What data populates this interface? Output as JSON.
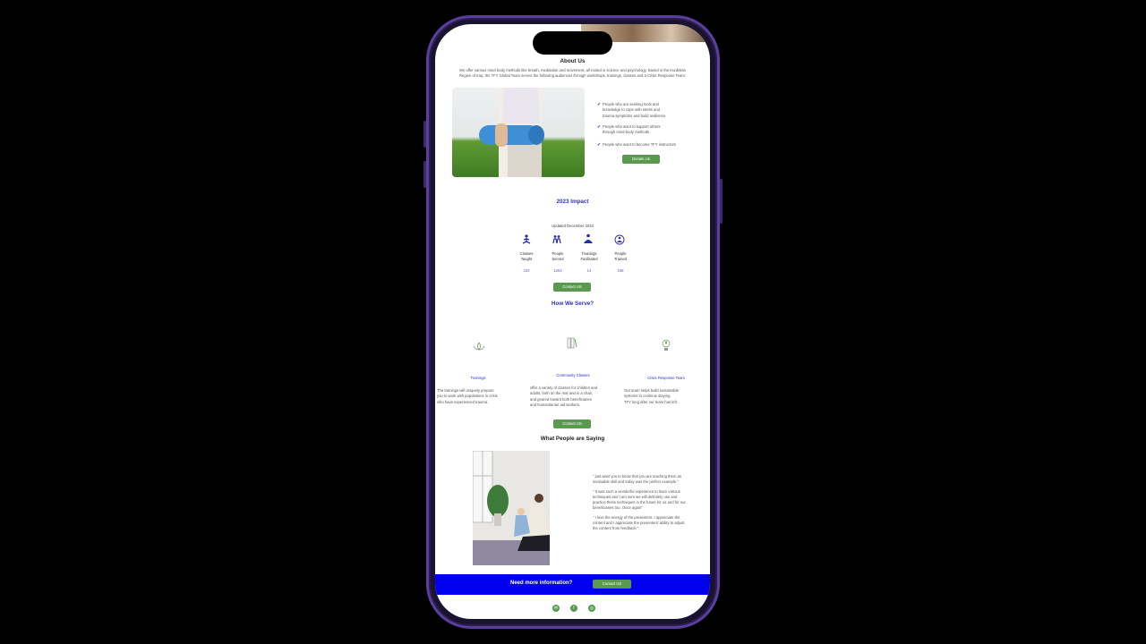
{
  "about": {
    "title": "About Us",
    "intro_line1": "We offer various mind-body methods like breath, meditation and movement, all rooted in science and psychology. Based in the Kurdistan",
    "intro_line2": "Region of Iraq, the TFY Global Team serves the following audiences through workshops, trainings, classes and a Crisis Response Team:",
    "audiences": [
      [
        "People who are seeking tools and",
        "knowledge to cope with stress and",
        "trauma symptoms and build resilience"
      ],
      [
        "People who want to support others",
        "through mind-body methods"
      ],
      [
        "People who want to become TFY instructors"
      ]
    ],
    "donate_label": "Donate Us"
  },
  "impact": {
    "title": "2023 Impact",
    "updated": "Updated December 2023",
    "stats": [
      {
        "label1": "Classes",
        "label2": "Taught",
        "value": "220",
        "icon": "meditation-person-icon"
      },
      {
        "label1": "People",
        "label2": "Served",
        "value": "1264",
        "icon": "people-served-icon"
      },
      {
        "label1": "Trainings",
        "label2": "Facilitated",
        "value": "14",
        "icon": "trainer-icon"
      },
      {
        "label1": "People",
        "label2": "Trained",
        "value": "168",
        "icon": "trained-group-icon"
      }
    ],
    "contact_label": "Contact US"
  },
  "serve": {
    "title": "How We Serve?",
    "items": [
      {
        "title": "Trainings",
        "icon": "lotus-icon",
        "desc": [
          "The trainings will uniquely prepare",
          "you to work with populations in crisis",
          "who have experienced trauma."
        ]
      },
      {
        "title": "Community Classes",
        "icon": "books-icon",
        "desc": [
          "offer a variety of classes for children and",
          "adults, both on the mat and in a chair,",
          "and geared toward both beneficiaries",
          "and humanitarian aid workers."
        ]
      },
      {
        "title": "Crisis Response Team",
        "icon": "growth-bulb-icon",
        "desc": [
          "Our team helps build sustainable",
          "systems to continue staying",
          "TFY long after our team has left."
        ]
      }
    ],
    "contact_label": "Contact US"
  },
  "testimonials": {
    "title": "What People are Saying",
    "quotes": [
      [
        "\" just want you to know that you are teaching them an",
        "invaluable skill and today was the perfect example.\""
      ],
      [
        "\" It was such a wonderful experience to learn various",
        "techniques and I am sure we will definitely use and",
        "practice these techniques in the future for us and for our",
        "beneficiaries too. Once again\""
      ],
      [
        "\" I love the energy of the presenters. I appreciate the",
        "content and I appreciate the presenters' ability to adjust",
        "the content from feedback.\""
      ]
    ]
  },
  "cta": {
    "text": "Need more information?",
    "button": "Contact US"
  },
  "footer": {
    "social": [
      {
        "icon": "email-icon"
      },
      {
        "icon": "facebook-icon"
      },
      {
        "icon": "instagram-icon"
      }
    ]
  },
  "colors": {
    "accent_green": "#5a9a4e",
    "cta_blue": "#0000ee",
    "heading_blue": "#2f2fd0"
  }
}
